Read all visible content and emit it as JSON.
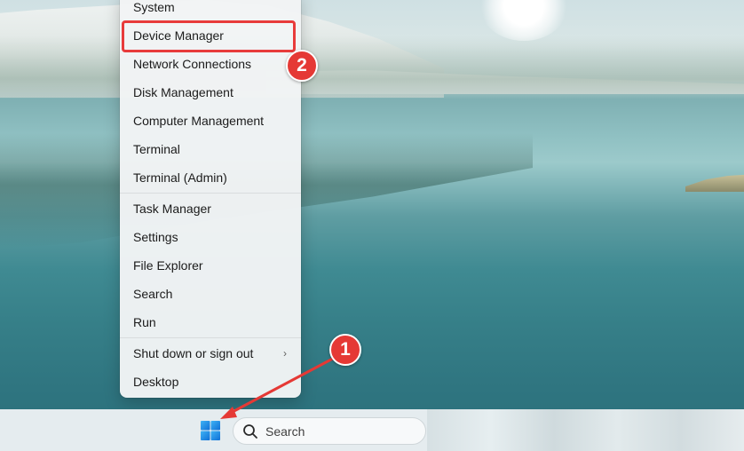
{
  "context_menu": {
    "items": [
      {
        "label": "System"
      },
      {
        "label": "Device Manager"
      },
      {
        "label": "Network Connections"
      },
      {
        "label": "Disk Management"
      },
      {
        "label": "Computer Management"
      },
      {
        "label": "Terminal"
      },
      {
        "label": "Terminal (Admin)"
      },
      {
        "label": "Task Manager"
      },
      {
        "label": "Settings"
      },
      {
        "label": "File Explorer"
      },
      {
        "label": "Search"
      },
      {
        "label": "Run"
      },
      {
        "label": "Shut down or sign out"
      },
      {
        "label": "Desktop"
      }
    ],
    "submenu_chevron": "›"
  },
  "annotations": {
    "step_1": "1",
    "step_2": "2",
    "color": "#e53935"
  },
  "taskbar": {
    "start_icon": "windows-logo-icon",
    "search_placeholder": "Search",
    "search_icon": "search-icon"
  }
}
